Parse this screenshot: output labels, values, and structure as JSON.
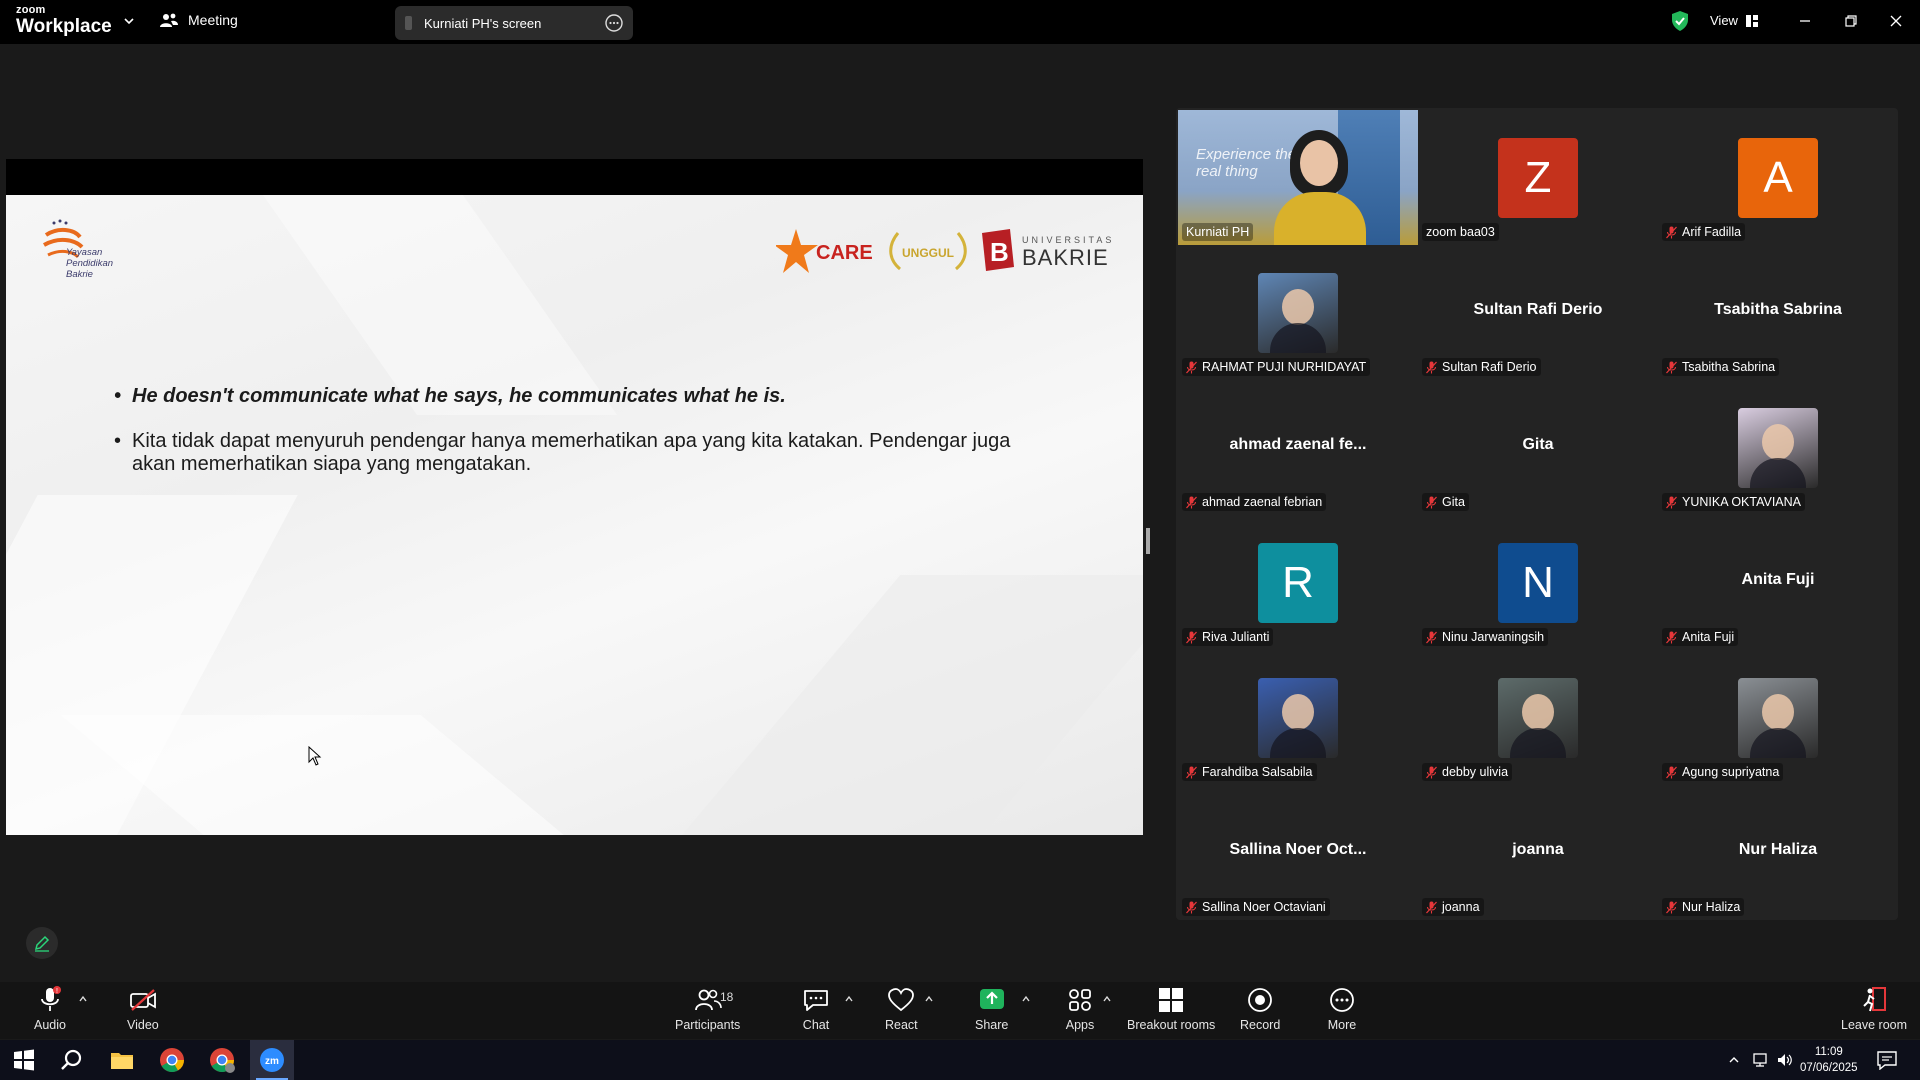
{
  "titlebar": {
    "brand_top": "zoom",
    "brand_bottom": "Workplace",
    "meeting_label": "Meeting",
    "screen_share_label": "Kurniati PH's screen",
    "view_label": "View"
  },
  "slide": {
    "logo_text": [
      "Yayasan",
      "Pendidikan",
      "Bakrie"
    ],
    "care_label": "CARE",
    "unggul_label": "UNGGUL",
    "univ_top": "UNIVERSITAS",
    "univ_bottom": "BAKRIE",
    "bullet1": "He doesn't communicate what he says, he communicates what he is.",
    "bullet2": "Kita tidak dapat menyuruh pendengar hanya memerhatikan apa yang kita katakan. Pendengar juga akan memerhatikan siapa yang mengatakan."
  },
  "participants": [
    {
      "name": "Kurniati PH",
      "kind": "video",
      "muted": false,
      "active": true,
      "video_text": "Experience the real thing"
    },
    {
      "name": "zoom baa03",
      "kind": "letter",
      "letter": "Z",
      "color": "#c4321c",
      "muted": false
    },
    {
      "name": "Arif Fadilla",
      "kind": "letter",
      "letter": "A",
      "color": "#e8650b",
      "muted": true
    },
    {
      "name": "RAHMAT PUJI NURHIDAYAT",
      "kind": "photo",
      "color": "#5f86b5",
      "muted": true
    },
    {
      "name": "Sultan Rafi Derio",
      "kind": "text",
      "display": "Sultan Rafi Derio",
      "muted": true
    },
    {
      "name": "Tsabitha Sabrina",
      "kind": "text",
      "display": "Tsabitha Sabrina",
      "muted": true
    },
    {
      "name": "ahmad zaenal febrian",
      "kind": "text",
      "display": "ahmad zaenal fe...",
      "muted": true
    },
    {
      "name": "Gita",
      "kind": "text",
      "display": "Gita",
      "muted": true
    },
    {
      "name": "YUNIKA OKTAVIANA",
      "kind": "photo",
      "color": "#d9cde0",
      "muted": true
    },
    {
      "name": "Riva Julianti",
      "kind": "letter",
      "letter": "R",
      "color": "#0e8f9e",
      "muted": true
    },
    {
      "name": "Ninu Jarwaningsih",
      "kind": "letter",
      "letter": "N",
      "color": "#0f4c8f",
      "muted": true
    },
    {
      "name": "Anita Fuji",
      "kind": "text",
      "display": "Anita Fuji",
      "muted": true
    },
    {
      "name": "Farahdiba Salsabila",
      "kind": "photo",
      "color": "#3a5fb0",
      "muted": true
    },
    {
      "name": "debby ulivia",
      "kind": "photo",
      "color": "#5d6b6a",
      "muted": true
    },
    {
      "name": "Agung supriyatna",
      "kind": "photo",
      "color": "#8a8f94",
      "muted": true
    },
    {
      "name": "Sallina Noer Octaviani",
      "kind": "text",
      "display": "Sallina Noer Oct...",
      "muted": true
    },
    {
      "name": "joanna",
      "kind": "text",
      "display": "joanna",
      "muted": true
    },
    {
      "name": "Nur Haliza",
      "kind": "text",
      "display": "Nur Haliza",
      "muted": true
    }
  ],
  "toolbar": {
    "audio": "Audio",
    "video": "Video",
    "participants": "Participants",
    "participants_count": "18",
    "chat": "Chat",
    "react": "React",
    "share": "Share",
    "apps": "Apps",
    "breakout": "Breakout rooms",
    "record": "Record",
    "more": "More",
    "leave": "Leave room"
  },
  "taskbar": {
    "time": "11:09",
    "date": "07/06/2025"
  },
  "colors": {
    "accent_green": "#2bd57a",
    "share_green": "#1fb35c",
    "leave_red": "#e5373a"
  }
}
